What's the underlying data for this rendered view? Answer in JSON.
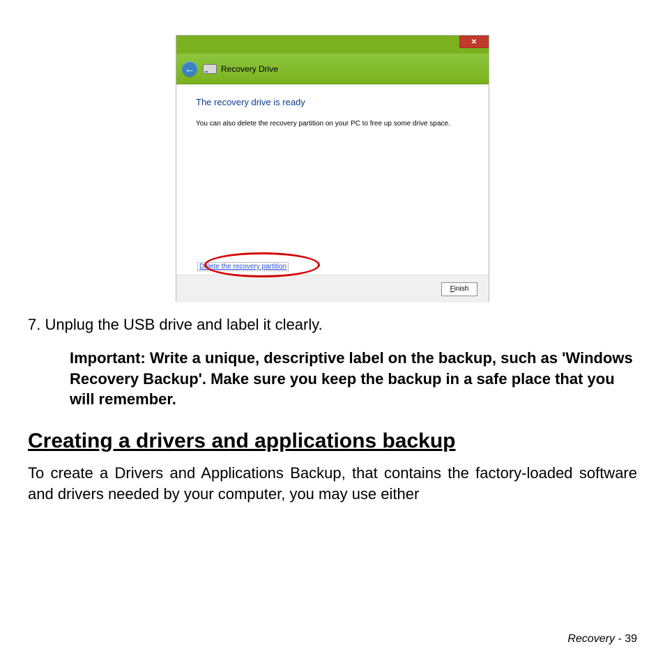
{
  "dialog": {
    "window_title": "Recovery Drive",
    "heading": "The recovery drive is ready",
    "subtext": "You can also delete the recovery partition on your PC to free up some drive space.",
    "delete_link": "Delete the recovery partition",
    "finish_prefix": "F",
    "finish_rest": "inish",
    "close_glyph": "✕"
  },
  "step": {
    "number": "7.",
    "text": "Unplug the USB drive and label it clearly."
  },
  "important": "Important: Write a unique, descriptive label on the backup, such as 'Windows Recovery Backup'. Make sure you keep the backup in a safe place that you will remember.",
  "section": {
    "heading": "Creating a drivers and applications backup",
    "body": "To create a Drivers and Applications Backup, that contains the factory-loaded software and drivers needed by your computer, you may use either"
  },
  "footer": {
    "label": "Recovery - ",
    "page": "39"
  }
}
